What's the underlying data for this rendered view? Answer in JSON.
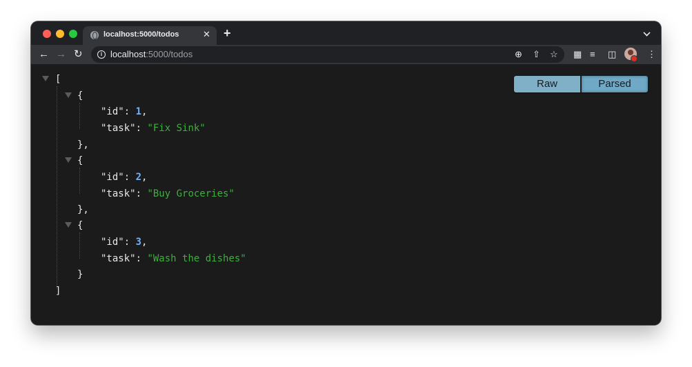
{
  "tab": {
    "title": "localhost:5000/todos",
    "close_glyph": "✕",
    "new_tab_glyph": "+"
  },
  "address_bar": {
    "host": "localhost",
    "path": ":5000/todos"
  },
  "icons": {
    "back": "back-arrow-icon",
    "forward": "forward-arrow-icon",
    "reload": "reload-icon",
    "info": "info-icon",
    "zoom": "zoom-icon",
    "share": "share-icon",
    "bookmark": "star-icon",
    "extensions": "puzzle-icon",
    "reading_list": "reading-list-icon",
    "side_panel": "side-panel-icon",
    "menu": "kebab-menu-icon"
  },
  "view_toggle": {
    "raw_label": "Raw",
    "parsed_label": "Parsed",
    "selected": "Parsed"
  },
  "json": {
    "open_bracket": "[",
    "close_bracket": "]",
    "items": [
      {
        "id": "1",
        "task": "\"Fix Sink\""
      },
      {
        "id": "2",
        "task": "\"Buy Groceries\""
      },
      {
        "id": "3",
        "task": "\"Wash the dishes\""
      }
    ],
    "id_key": "\"id\"",
    "task_key": "\"task\""
  },
  "colors": {
    "number": "#6fb3ff",
    "string": "#3fae3f",
    "background": "#1b1b1b"
  }
}
